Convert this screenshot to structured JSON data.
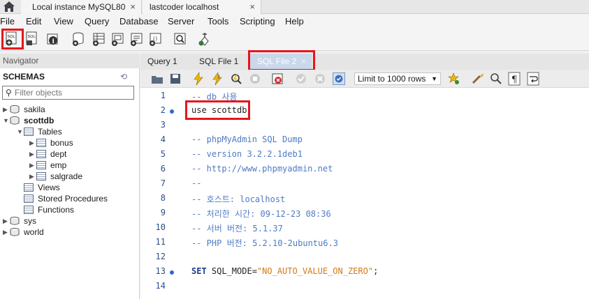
{
  "window_tabs": [
    {
      "label": "Local instance MySQL80"
    },
    {
      "label": "lastcoder localhost"
    }
  ],
  "menu": [
    "File",
    "Edit",
    "View",
    "Query",
    "Database",
    "Server",
    "Tools",
    "Scripting",
    "Help"
  ],
  "navigator": {
    "header": "Navigator",
    "schemas_label": "SCHEMAS",
    "filter_placeholder": "Filter objects",
    "tree": {
      "sakila": "sakila",
      "scottdb": "scottdb",
      "tables": "Tables",
      "table_items": [
        "bonus",
        "dept",
        "emp",
        "salgrade"
      ],
      "views": "Views",
      "stored_procedures": "Stored Procedures",
      "functions": "Functions",
      "sys": "sys",
      "world": "world"
    }
  },
  "query_tabs": [
    {
      "label": "Query 1"
    },
    {
      "label": "SQL File 1"
    },
    {
      "label": "SQL File 2",
      "active": true
    }
  ],
  "editor_toolbar": {
    "limit_label": "Limit to 1000 rows"
  },
  "editor": {
    "lines": [
      {
        "n": "1",
        "text": "-- db 사용",
        "kind": "comment",
        "dot": false
      },
      {
        "n": "2",
        "text": "use scottdb;",
        "kind": "plain",
        "dot": true
      },
      {
        "n": "3",
        "text": "",
        "kind": "plain",
        "dot": false
      },
      {
        "n": "4",
        "text": "-- phpMyAdmin SQL Dump",
        "kind": "comment",
        "dot": false
      },
      {
        "n": "5",
        "text": "-- version 3.2.2.1deb1",
        "kind": "comment",
        "dot": false
      },
      {
        "n": "6",
        "text": "-- http://www.phpmyadmin.net",
        "kind": "comment",
        "dot": false
      },
      {
        "n": "7",
        "text": "--",
        "kind": "comment",
        "dot": false
      },
      {
        "n": "8",
        "text": "-- 호스트: localhost",
        "kind": "comment",
        "dot": false
      },
      {
        "n": "9",
        "text": "-- 처리한 시간: 09-12-23 08:36",
        "kind": "comment",
        "dot": false
      },
      {
        "n": "10",
        "text": "-- 서버 버전: 5.1.37",
        "kind": "comment",
        "dot": false
      },
      {
        "n": "11",
        "text": "-- PHP 버전: 5.2.10-2ubuntu6.3",
        "kind": "comment",
        "dot": false
      },
      {
        "n": "12",
        "text": "",
        "kind": "plain",
        "dot": false
      },
      {
        "n": "13",
        "text_kw": "SET",
        "text_mid": " SQL_MODE=",
        "text_str": "\"NO_AUTO_VALUE_ON_ZERO\"",
        "text_end": ";",
        "kind": "set",
        "dot": true
      },
      {
        "n": "14",
        "text": "",
        "kind": "plain",
        "dot": false
      }
    ]
  },
  "colors": {
    "highlight_red": "#e8141c",
    "active_tab_bg": "#c9d8ea",
    "comment": "#4f7bc4",
    "string": "#d07a16"
  }
}
